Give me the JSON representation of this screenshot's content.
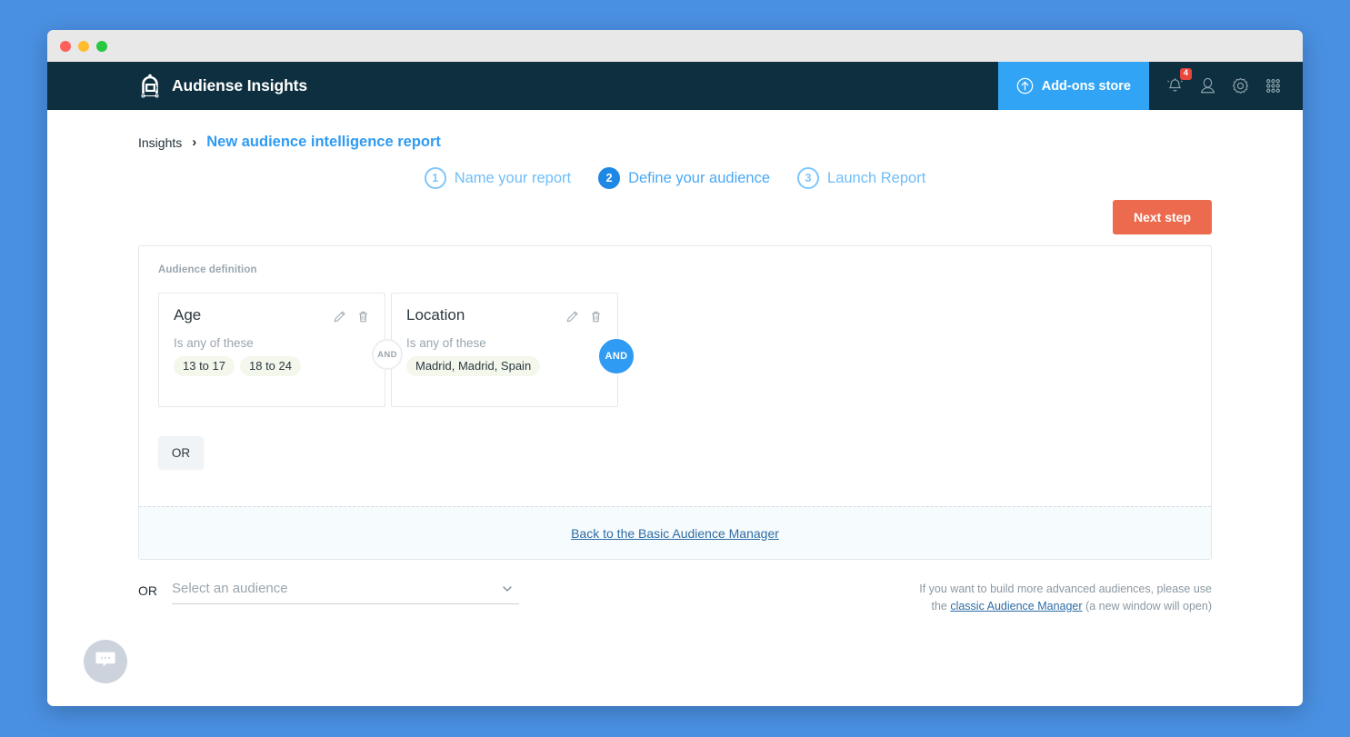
{
  "window": {
    "controls": [
      "close",
      "minimize",
      "maximize"
    ]
  },
  "navbar": {
    "brand_title": "Audiense Insights",
    "brand_logo_icon": "audiense-a-logo-icon",
    "addons": {
      "label": "Add-ons store",
      "icon": "arrow-up-circle-icon"
    },
    "icons": [
      {
        "name": "notifications-bell-icon",
        "badge": "4"
      },
      {
        "name": "user-profile-icon",
        "badge": ""
      },
      {
        "name": "settings-gear-icon",
        "badge": ""
      },
      {
        "name": "apps-grid-icon",
        "badge": ""
      }
    ]
  },
  "breadcrumb": {
    "root": "Insights",
    "separator": "›",
    "current": "New audience intelligence report"
  },
  "steps": [
    {
      "number": "1",
      "label": "Name your report",
      "active": false
    },
    {
      "number": "2",
      "label": "Define your audience",
      "active": true
    },
    {
      "number": "3",
      "label": "Launch Report",
      "active": false
    }
  ],
  "actions": {
    "next_step_label": "Next step",
    "next_step_color": "#ec6a4d"
  },
  "panel": {
    "caption": "Audience definition",
    "cards": [
      {
        "title": "Age",
        "operator": "Is any of these",
        "values": [
          "13 to 17",
          "18 to 24"
        ],
        "edit_icon": "pencil-edit-icon",
        "delete_icon": "trash-delete-icon"
      },
      {
        "title": "Location",
        "operator": "Is any of these",
        "values": [
          "Madrid, Madrid, Spain"
        ],
        "edit_icon": "pencil-edit-icon",
        "delete_icon": "trash-delete-icon"
      }
    ],
    "connectors": {
      "inner_and": "AND",
      "outer_and": "AND",
      "inner_and_color": "#9aa5ad",
      "outer_and_color": "#2f9bf2"
    },
    "or_button_label": "OR",
    "footer_link": "Back to the Basic Audience Manager"
  },
  "bottom": {
    "or_label": "OR",
    "select_placeholder": "Select an audience",
    "chevron_icon": "chevron-down-icon",
    "hint_line1": "If you want to build more advanced audiences, please use",
    "hint_prefix": "the ",
    "hint_link": "classic Audience Manager",
    "hint_suffix": " (a new window will open)"
  },
  "chat": {
    "icon": "chat-bubble-icon"
  }
}
